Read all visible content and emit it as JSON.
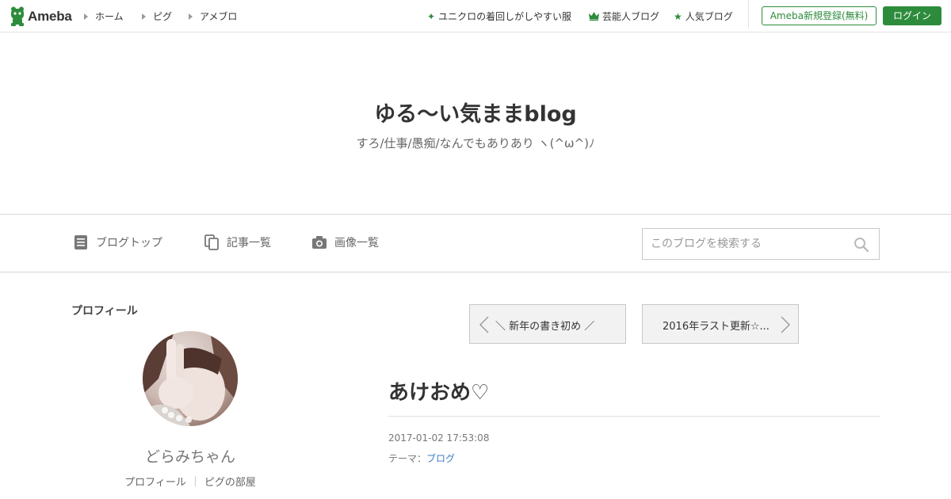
{
  "topbar": {
    "logo_text": "Ameba",
    "nav": [
      "ホーム",
      "ピグ",
      "アメブロ"
    ],
    "promos": [
      {
        "icon": "sparkle-icon",
        "label": "ユニクロの着回しがしやすい服"
      },
      {
        "icon": "crown-icon",
        "label": "芸能人ブログ"
      },
      {
        "icon": "star-icon",
        "label": "人気ブログ"
      }
    ],
    "register_label": "Ameba新規登録(無料)",
    "login_label": "ログイン"
  },
  "header": {
    "title": "ゆる〜い気ままblog",
    "description": "すろ/仕事/愚痴/なんでもありあり ヽ(^ω^)ﾉ"
  },
  "blognav": {
    "items": [
      {
        "icon": "document-icon",
        "label": "ブログトップ"
      },
      {
        "icon": "copy-icon",
        "label": "記事一覧"
      },
      {
        "icon": "camera-icon",
        "label": "画像一覧"
      }
    ],
    "search_placeholder": "このブログを検索する"
  },
  "sidebar": {
    "heading": "プロフィール",
    "name": "どらみちゃん",
    "links": [
      "プロフィール",
      "ピグの部屋"
    ]
  },
  "pager": {
    "prev_label": "＼ 新年の書き初め ／",
    "next_label": "2016年ラスト更新☆..."
  },
  "post": {
    "title": "あけおめ♡",
    "date": "2017-01-02 17:53:08",
    "theme_prefix": "テーマ：",
    "theme": "ブログ"
  },
  "colors": {
    "brand_green": "#2d8c3c",
    "link_blue": "#3b7dc4"
  }
}
